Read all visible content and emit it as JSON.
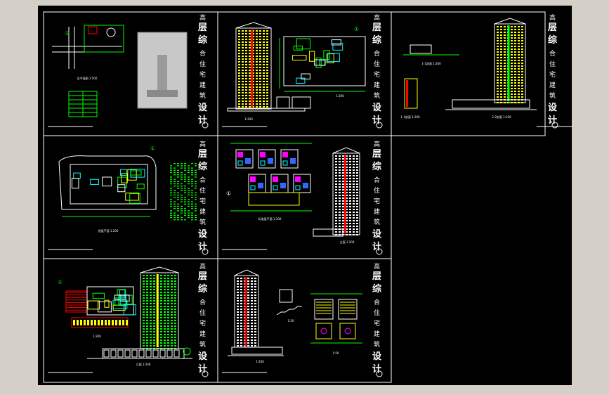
{
  "drawing": {
    "background": "#000000",
    "frame_color": "#ffffff",
    "sheet_title_chars": [
      "高",
      "层",
      "综",
      "合",
      "住",
      "宅",
      "建",
      "筑",
      "设",
      "计"
    ],
    "colors": {
      "green": "#00ff00",
      "cyan": "#00ffff",
      "yellow": "#ffff00",
      "red": "#ff0000",
      "magenta": "#ff00ff",
      "white": "#ffffff",
      "blue": "#3366ff"
    }
  },
  "panels": [
    {
      "id": "site-plan-sheet",
      "caption": "总平面图 1:500"
    },
    {
      "id": "elevation-plan-sheet",
      "caption": "1:200"
    },
    {
      "id": "section-sheet",
      "caption": "1-1剖面 1:200",
      "caption2": "2-2剖面 1:200"
    },
    {
      "id": "ground-floor-sheet",
      "caption": "首层平面 1:200"
    },
    {
      "id": "typical-floor-sheet",
      "caption": "标准层平面 1:100",
      "caption2": "立面 1:200"
    },
    {
      "id": "side-elevation-sheet",
      "caption": "1:200",
      "caption2": "立面 1:200"
    },
    {
      "id": "detail-sheet",
      "caption": "1:200",
      "caption2": "1:50",
      "caption3": "1:50"
    }
  ]
}
